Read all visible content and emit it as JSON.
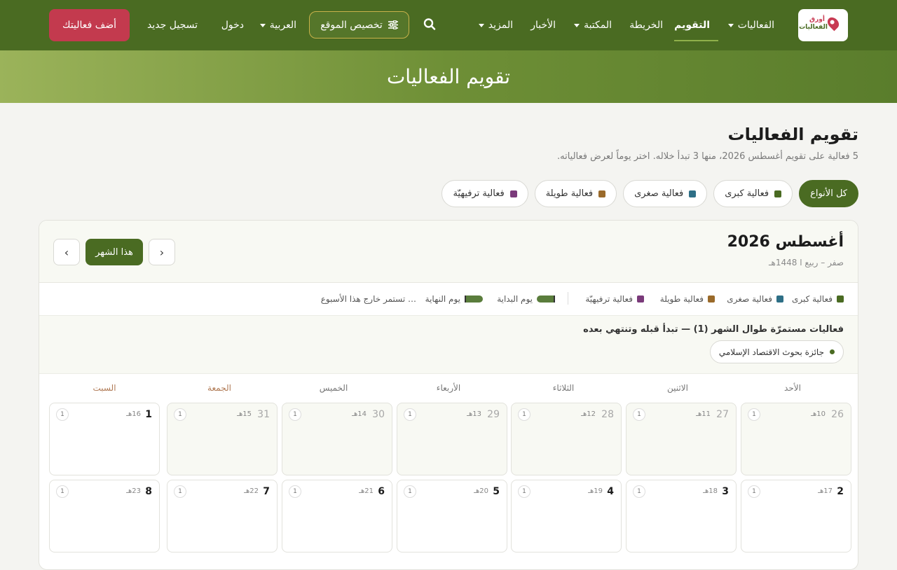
{
  "nav": {
    "logo_line1": "أورق",
    "logo_line2": "الفعاليات",
    "events": "الفعاليات",
    "calendar": "التقويم",
    "map": "الخريطة",
    "library": "المكتبة",
    "news": "الأخبار",
    "more": "المزيد",
    "customize": "تخصيص الموقع",
    "language": "العربية",
    "login": "دخول",
    "register": "تسجيل جديد",
    "add_event": "أضف فعاليتك"
  },
  "hero": {
    "title": "تقويم الفعاليات"
  },
  "header": {
    "title": "تقويم الفعاليات",
    "subtitle": "5 فعالية على تقويم أغسطس 2026، منها 3 تبدأ خلاله. اختر يوماً لعرض فعالياته."
  },
  "filters": [
    {
      "label": "كل الأنواع",
      "color": ""
    },
    {
      "label": "فعالية كبرى",
      "color": "#4a6b22"
    },
    {
      "label": "فعالية صغرى",
      "color": "#2e6f86"
    },
    {
      "label": "فعالية طويلة",
      "color": "#9a6a2a"
    },
    {
      "label": "فعالية ترفيهيّة",
      "color": "#7a3a7a"
    }
  ],
  "calendar": {
    "month": "أغسطس 2026",
    "hijri": "صفر – ربيع ا 1448هـ",
    "today": "هذا الشهر",
    "prev": "‹",
    "next": "›",
    "legend": {
      "major": "فعالية كبرى",
      "minor": "فعالية صغرى",
      "long": "فعالية طويلة",
      "fun": "فعالية ترفيهيّة",
      "start": "يوم البداية",
      "end": "يوم النهاية",
      "continues": "… تستمر خارج هذا الأسبوع"
    },
    "ongoing_title": "فعاليات مستمرّة طوال الشهر (1) — تبدأ قبله وتنتهي بعده",
    "ongoing_event": "جائزة بحوث الاقتصاد الإسلامي",
    "weekdays": [
      "الأحد",
      "الاثنين",
      "الثلاثاء",
      "الأربعاء",
      "الخميس",
      "الجمعة",
      "السبت"
    ],
    "week1": [
      {
        "num": "26",
        "h": "10هـ",
        "count": "1"
      },
      {
        "num": "27",
        "h": "11هـ",
        "count": "1"
      },
      {
        "num": "28",
        "h": "12هـ",
        "count": "1"
      },
      {
        "num": "29",
        "h": "13هـ",
        "count": "1"
      },
      {
        "num": "30",
        "h": "14هـ",
        "count": "1"
      },
      {
        "num": "31",
        "h": "15هـ",
        "count": "1"
      },
      {
        "num": "1",
        "h": "16هـ",
        "count": "1"
      }
    ],
    "week2": [
      {
        "num": "2",
        "h": "17هـ",
        "count": "1"
      },
      {
        "num": "3",
        "h": "18هـ",
        "count": "1"
      },
      {
        "num": "4",
        "h": "19هـ",
        "count": "1"
      },
      {
        "num": "5",
        "h": "20هـ",
        "count": "1"
      },
      {
        "num": "6",
        "h": "21هـ",
        "count": "1"
      },
      {
        "num": "7",
        "h": "22هـ",
        "count": "1"
      },
      {
        "num": "8",
        "h": "23هـ",
        "count": "1"
      }
    ]
  }
}
